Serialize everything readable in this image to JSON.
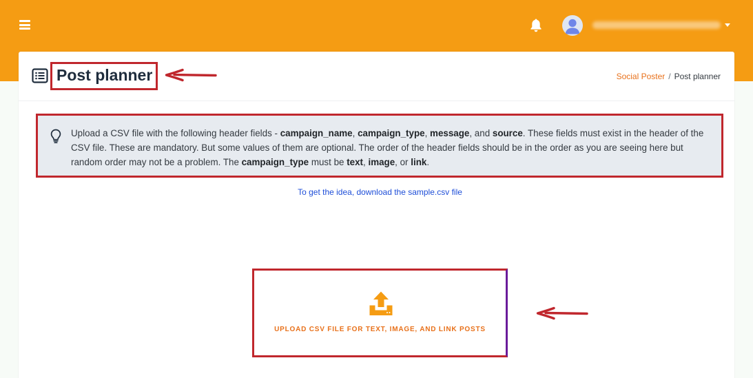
{
  "header": {
    "menu_icon": "hamburger-menu-icon",
    "notification_icon": "bell-icon",
    "user_icon": "user-avatar-icon",
    "dropdown_icon": "caret-down-icon",
    "accent_color": "#f59c13"
  },
  "page": {
    "title": "Post planner",
    "title_icon": "list-alt-icon"
  },
  "breadcrumb": {
    "parent": "Social Poster",
    "separator": "/",
    "current": "Post planner"
  },
  "info": {
    "icon": "lightbulb-icon",
    "p1": "Upload a CSV file with the following header fields - ",
    "f1": "campaign_name",
    "s1": ", ",
    "f2": "campaign_type",
    "s2": ", ",
    "f3": "message",
    "s3": ", and ",
    "f4": "source",
    "p2": ". These fields must exist in the header of the CSV file. These are mandatory. But some values of them are optional. The order of the header fields should be in the order as you are seeing here but random order may not be a problem. The ",
    "f5": "campaign_type",
    "p3": " must be ",
    "f6": "text",
    "s4": ", ",
    "f7": "image",
    "s5": ", or ",
    "f8": "link",
    "p4": "."
  },
  "sample_link": "To get the idea, download the sample.csv file",
  "upload": {
    "icon": "upload-icon",
    "label": "UPLOAD CSV FILE FOR TEXT, IMAGE, AND LINK POSTS"
  },
  "annotation": {
    "arrow_color": "#c0272d",
    "highlight_color": "#c0272d"
  }
}
